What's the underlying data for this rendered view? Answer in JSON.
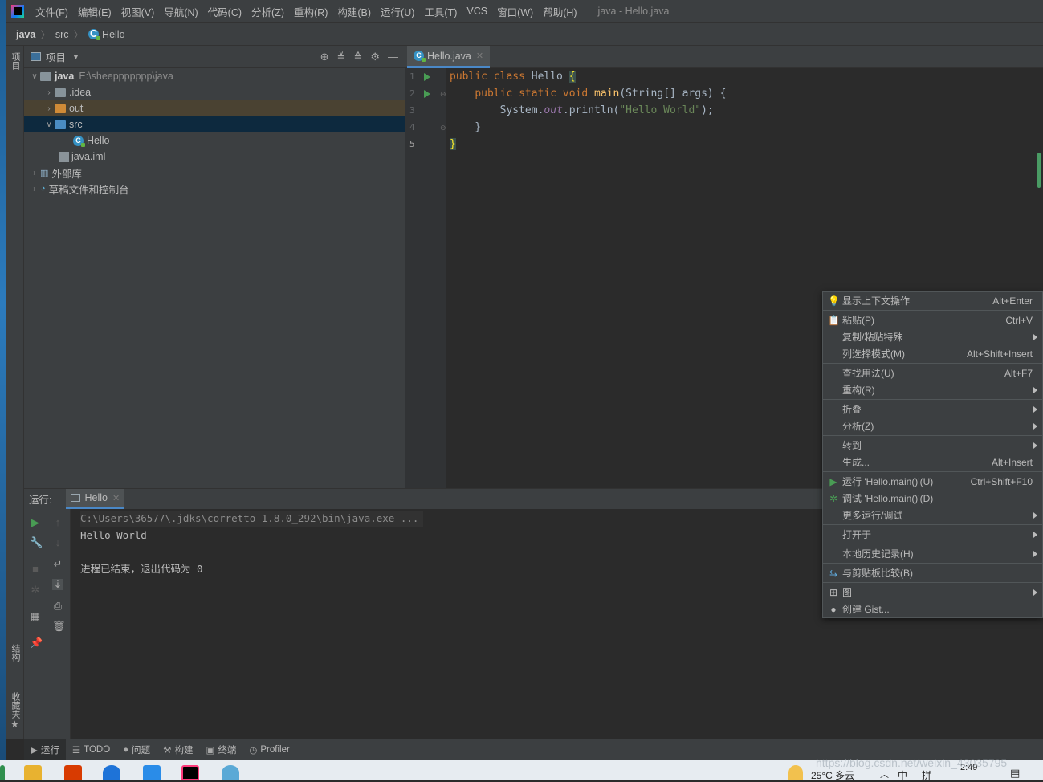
{
  "menubar": {
    "items": [
      "文件(F)",
      "编辑(E)",
      "视图(V)",
      "导航(N)",
      "代码(C)",
      "分析(Z)",
      "重构(R)",
      "构建(B)",
      "运行(U)",
      "工具(T)",
      "VCS",
      "窗口(W)",
      "帮助(H)"
    ],
    "window_title": "java - Hello.java"
  },
  "breadcrumb": [
    "java",
    "src",
    "Hello"
  ],
  "left_stripe": {
    "top_tab": "项目",
    "structure_tab": "结构",
    "favorites_tab": "收藏夹"
  },
  "project": {
    "title": "项目",
    "tree": [
      {
        "label": "java",
        "hint": "E:\\sheeppppppp\\java"
      },
      {
        "label": ".idea"
      },
      {
        "label": "out"
      },
      {
        "label": "src"
      },
      {
        "label": "Hello"
      },
      {
        "label": "java.iml"
      },
      {
        "label": "外部库"
      },
      {
        "label": "草稿文件和控制台"
      }
    ]
  },
  "editor": {
    "tab": "Hello.java",
    "line_numbers": [
      "1",
      "2",
      "3",
      "4",
      "5"
    ],
    "code": {
      "l1_kw": "public class ",
      "l1_name": "Hello ",
      "l1_brace": "{",
      "l2_indent": "    ",
      "l2_kw": "public static void ",
      "l2_fn": "main",
      "l2_rest": "(String[] args) {",
      "l3_indent": "        ",
      "l3_a": "System.",
      "l3_fld": "out",
      "l3_b": ".println(",
      "l3_str": "\"Hello World\"",
      "l3_c": ");",
      "l4": "    }",
      "l5": "}"
    }
  },
  "run": {
    "label": "运行:",
    "tab": "Hello",
    "console": [
      "C:\\Users\\36577\\.jdks\\corretto-1.8.0_292\\bin\\java.exe ...",
      "Hello World",
      "",
      "进程已结束，退出代码为 0"
    ]
  },
  "bottom_bar": [
    "运行",
    "TODO",
    "问题",
    "构建",
    "终端",
    "Profiler"
  ],
  "context_menu": {
    "items": [
      {
        "label": "显示上下文操作",
        "shortcut": "Alt+Enter"
      },
      {
        "label": "粘贴(P)",
        "shortcut": "Ctrl+V"
      },
      {
        "label": "复制/粘贴特殊",
        "shortcut": ""
      },
      {
        "label": "列选择模式(M)",
        "shortcut": "Alt+Shift+Insert"
      },
      {
        "label": "查找用法(U)",
        "shortcut": "Alt+F7"
      },
      {
        "label": "重构(R)",
        "shortcut": ""
      },
      {
        "label": "折叠",
        "shortcut": ""
      },
      {
        "label": "分析(Z)",
        "shortcut": ""
      },
      {
        "label": "转到",
        "shortcut": ""
      },
      {
        "label": "生成...",
        "shortcut": "Alt+Insert"
      },
      {
        "label": "运行 'Hello.main()'(U)",
        "shortcut": "Ctrl+Shift+F10"
      },
      {
        "label": "调试 'Hello.main()'(D)",
        "shortcut": ""
      },
      {
        "label": "更多运行/调试",
        "shortcut": ""
      },
      {
        "label": "打开于",
        "shortcut": ""
      },
      {
        "label": "本地历史记录(H)",
        "shortcut": ""
      },
      {
        "label": "与剪贴板比较(B)",
        "shortcut": ""
      },
      {
        "label": "图",
        "shortcut": ""
      },
      {
        "label": "创建 Gist...",
        "shortcut": ""
      }
    ]
  },
  "taskbar": {
    "weather": "25°C 多云",
    "ime": "中",
    "ime2": "拼",
    "time": "2:49"
  },
  "watermark": "https://blog.csdn.net/weixin_43035795"
}
